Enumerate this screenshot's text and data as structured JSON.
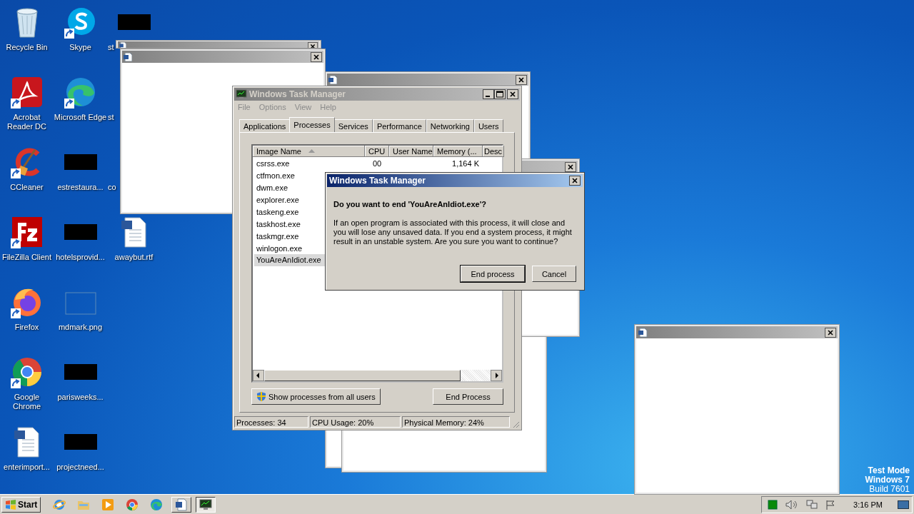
{
  "desktop_icons": [
    {
      "label": "Recycle Bin",
      "kind": "recycle",
      "covered": false
    },
    {
      "label": "Acrobat Reader DC",
      "kind": "acrobat",
      "covered": false
    },
    {
      "label": "CCleaner",
      "kind": "ccleaner",
      "covered": false
    },
    {
      "label": "FileZilla Client",
      "kind": "filezilla",
      "covered": false
    },
    {
      "label": "Firefox",
      "kind": "firefox",
      "covered": false
    },
    {
      "label": "Google Chrome",
      "kind": "chrome",
      "covered": false
    },
    {
      "label": "enterimport...",
      "kind": "word",
      "covered": false
    },
    {
      "label": "Skype",
      "kind": "skype",
      "covered": false
    },
    {
      "label": "Microsoft Edge",
      "kind": "edge",
      "covered": false
    },
    {
      "label": "estrestaura...",
      "kind": "redacted",
      "covered": false
    },
    {
      "label": "hotelsprovid...",
      "kind": "redacted",
      "covered": false
    },
    {
      "label": "mdmark.png",
      "kind": "image",
      "covered": false
    },
    {
      "label": "parisweeks...",
      "kind": "redacted",
      "covered": false
    },
    {
      "label": "projectneed...",
      "kind": "redacted",
      "covered": false
    },
    {
      "label": "st",
      "kind": "redacted",
      "covered": true
    },
    {
      "label": "st",
      "kind": "hidden",
      "covered": true
    },
    {
      "label": "co",
      "kind": "hidden",
      "covered": true
    },
    {
      "label": "awaybut.rtf",
      "kind": "word",
      "covered": false
    }
  ],
  "task_manager": {
    "title": "Windows Task Manager",
    "menu": [
      "File",
      "Options",
      "View",
      "Help"
    ],
    "tabs": [
      {
        "label": "Applications",
        "selected": false
      },
      {
        "label": "Processes",
        "selected": true
      },
      {
        "label": "Services",
        "selected": false
      },
      {
        "label": "Performance",
        "selected": false
      },
      {
        "label": "Networking",
        "selected": false
      },
      {
        "label": "Users",
        "selected": false
      }
    ],
    "columns": [
      "Image Name",
      "CPU",
      "User Name",
      "Memory (...",
      "Desc"
    ],
    "rows": [
      {
        "name": "csrss.exe",
        "cpu": "00",
        "memory": "1,164 K",
        "selected": false
      },
      {
        "name": "ctfmon.exe",
        "selected": false
      },
      {
        "name": "dwm.exe",
        "selected": false
      },
      {
        "name": "explorer.exe",
        "selected": false
      },
      {
        "name": "taskeng.exe",
        "selected": false
      },
      {
        "name": "taskhost.exe",
        "selected": false
      },
      {
        "name": "taskmgr.exe",
        "selected": false
      },
      {
        "name": "winlogon.exe",
        "selected": false
      },
      {
        "name": "YouAreAnIdiot.exe",
        "selected": true
      }
    ],
    "show_all_button": "Show processes from all users",
    "end_button": "End Process",
    "status": [
      "Processes: 34",
      "CPU Usage: 20%",
      "Physical Memory: 24%"
    ]
  },
  "dialog": {
    "title": "Windows Task Manager",
    "question": "Do you want to end 'YouAreAnIdiot.exe'?",
    "message": "If an open program is associated with this process, it will close and you will lose any unsaved data. If you end a system process, it might result in an unstable system. Are you sure you want to continue?",
    "buttons": [
      {
        "label": "End process",
        "default": true
      },
      {
        "label": "Cancel",
        "default": false
      }
    ]
  },
  "watermark_lines": [
    {
      "text": "Test Mode",
      "kind": "bold"
    },
    {
      "text": "Windows 7",
      "kind": "bold"
    },
    {
      "text": "Build 7601",
      "kind": "plain"
    }
  ],
  "taskbar": {
    "start": "Start",
    "quick_launch": [
      {
        "kind": "ie"
      },
      {
        "kind": "folder"
      },
      {
        "kind": "media"
      },
      {
        "kind": "chrome"
      },
      {
        "kind": "edge"
      }
    ],
    "tasks": [
      {
        "kind": "word",
        "selected": false
      },
      {
        "kind": "taskmgr",
        "selected": true
      }
    ],
    "clock": "3:16 PM"
  }
}
